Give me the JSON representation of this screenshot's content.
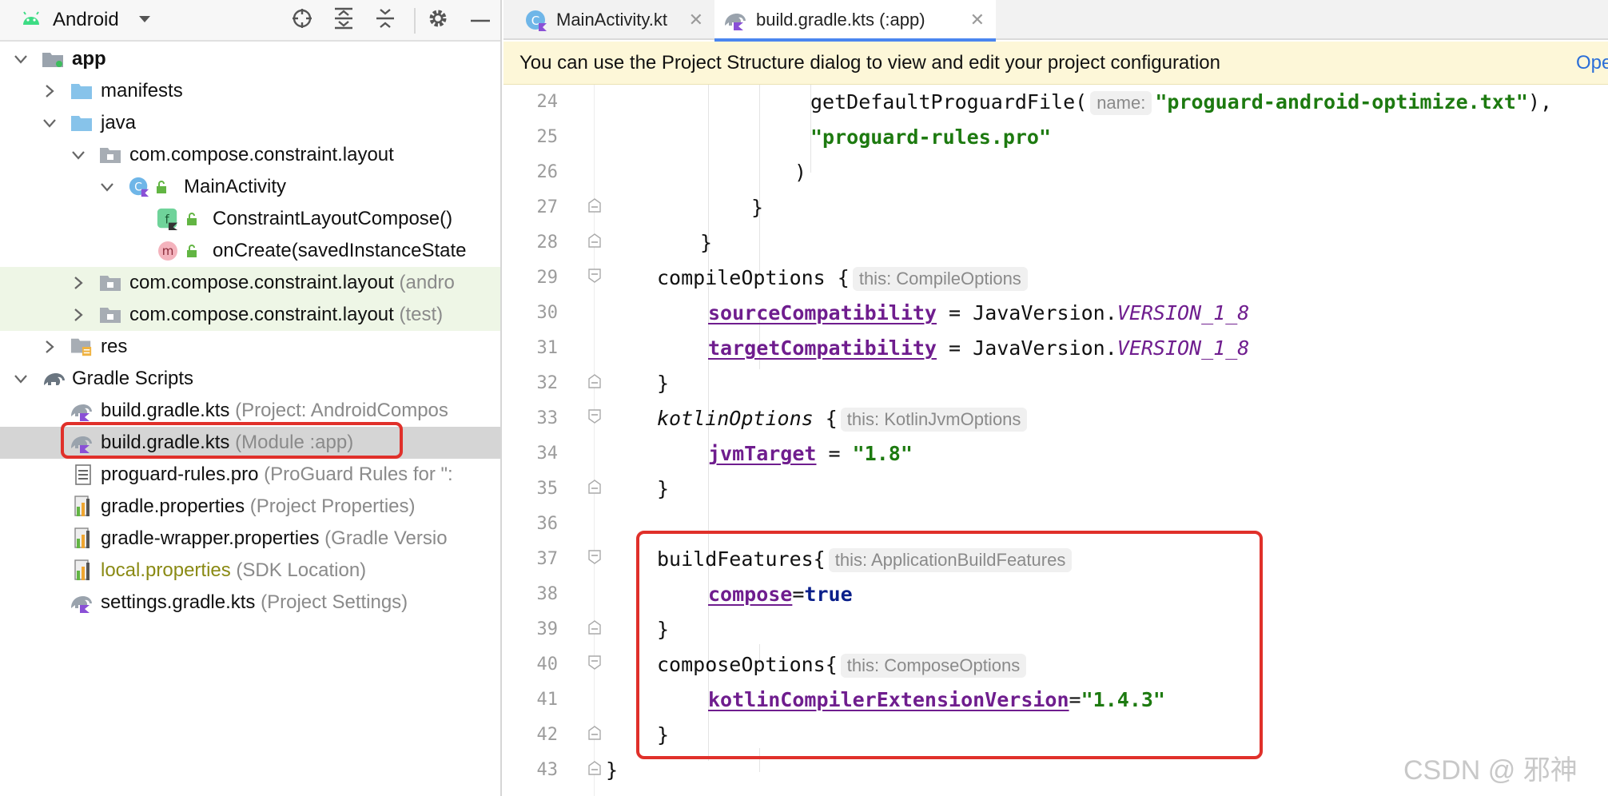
{
  "left_panel": {
    "view_selector": "Android",
    "toolbar": {
      "locate": "locate-icon",
      "expand_all": "expand-all-icon",
      "collapse_all": "collapse-all-icon",
      "settings": "gear-icon",
      "hide": "minus-icon"
    },
    "tree": [
      {
        "label": "app",
        "hint": ""
      },
      {
        "label": "manifests",
        "hint": ""
      },
      {
        "label": "java",
        "hint": ""
      },
      {
        "label": "com.compose.constraint.layout",
        "hint": ""
      },
      {
        "label": "MainActivity",
        "hint": ""
      },
      {
        "label": "ConstraintLayoutCompose()",
        "hint": ""
      },
      {
        "label": "onCreate(savedInstanceState",
        "hint": ""
      },
      {
        "label": "com.compose.constraint.layout",
        "hint": "(andro"
      },
      {
        "label": "com.compose.constraint.layout",
        "hint": "(test)"
      },
      {
        "label": "res",
        "hint": ""
      },
      {
        "label": "Gradle Scripts",
        "hint": ""
      },
      {
        "label": "build.gradle.kts",
        "hint": "(Project: AndroidCompos"
      },
      {
        "label": "build.gradle.kts",
        "hint": "(Module :app)"
      },
      {
        "label": "proguard-rules.pro",
        "hint": "(ProGuard Rules for \":"
      },
      {
        "label": "gradle.properties",
        "hint": "(Project Properties)"
      },
      {
        "label": "gradle-wrapper.properties",
        "hint": "(Gradle Versio"
      },
      {
        "label": "local.properties",
        "hint": "(SDK Location)"
      },
      {
        "label": "settings.gradle.kts",
        "hint": "(Project Settings)"
      }
    ],
    "method_badge": "m",
    "function_badge": "f"
  },
  "editor": {
    "tabs": [
      {
        "label": "MainActivity.kt"
      },
      {
        "label": "build.gradle.kts (:app)"
      }
    ],
    "banner": {
      "text": "You can use the Project Structure dialog to view and edit your project configuration",
      "link": "Ope"
    },
    "line_numbers": [
      "24",
      "25",
      "26",
      "27",
      "28",
      "29",
      "30",
      "31",
      "32",
      "33",
      "34",
      "35",
      "36",
      "37",
      "38",
      "39",
      "40",
      "41",
      "42",
      "43"
    ],
    "code": {
      "l24_fn": "getDefaultProguardFile(",
      "l24_hint": "name:",
      "l24_str": "\"proguard-android-optimize.txt\"",
      "l24_end": "),",
      "l25_str": "\"proguard-rules.pro\"",
      "l26": ")",
      "l27": "}",
      "l28": "}",
      "l29_name": "compileOptions {",
      "l29_hint": "this: CompileOptions",
      "l30_prop": "sourceCompatibility",
      "l30_mid": " = JavaVersion.",
      "l30_const": "VERSION_1_8",
      "l31_prop": "targetCompatibility",
      "l31_mid": " = JavaVersion.",
      "l31_const": "VERSION_1_8",
      "l32": "}",
      "l33_name": "kotlinOptions",
      "l33_brace": " {",
      "l33_hint": "this: KotlinJvmOptions",
      "l34_prop": "jvmTarget",
      "l34_mid": " = ",
      "l34_str": "\"1.8\"",
      "l35": "}",
      "l37_name": "buildFeatures{",
      "l37_hint": "this: ApplicationBuildFeatures",
      "l38_prop": "compose",
      "l38_mid": "=",
      "l38_kw": "true",
      "l39": "}",
      "l40_name": "composeOptions{",
      "l40_hint": "this: ComposeOptions",
      "l41_prop": "kotlinCompilerExtensionVersion",
      "l41_mid": "=",
      "l41_str": "\"1.4.3\"",
      "l42": "}",
      "l43": "}"
    }
  },
  "watermark": "CSDN @ 邪神",
  "colors": {
    "highlight_box": "#e0302a",
    "string": "#1d7a10",
    "property": "#6f1d8e",
    "keyword": "#0a1f8a",
    "banner_bg": "#fdf7d8",
    "selection": "#d5d5d5"
  }
}
